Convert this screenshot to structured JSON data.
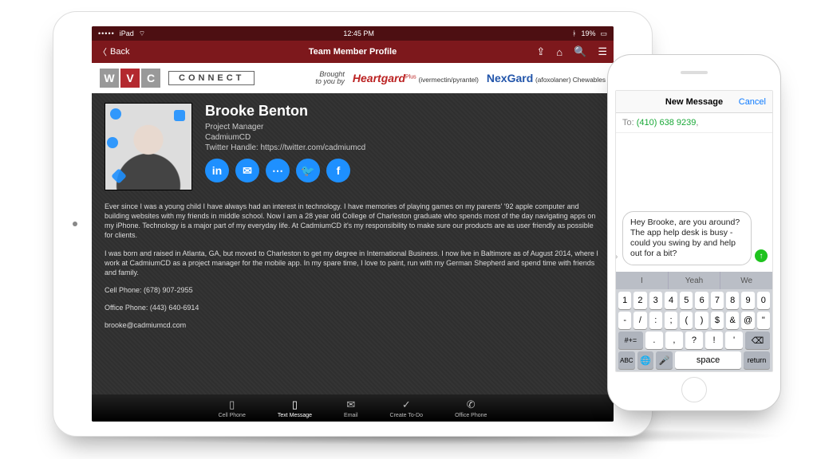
{
  "ipad": {
    "statusbar": {
      "carrier": "iPad",
      "wifi": "᯾",
      "time": "12:45 PM",
      "bt": "ᚼ",
      "battery_pct": "19%"
    },
    "navbar": {
      "back": "Back",
      "title": "Team Member Profile",
      "icons": {
        "share": "share-icon",
        "home": "home-icon",
        "search": "search-icon",
        "menu": "menu-icon"
      }
    },
    "banner": {
      "wvc_letters": [
        "W",
        "V",
        "C"
      ],
      "connect": "CONNECT",
      "brought_line1": "Brought",
      "brought_line2": "to you by",
      "heartgard": "Heartgard",
      "heartgard_sub": "(ivermectin/pyrantel)",
      "heartgard_plus": "Plus",
      "nexgard": "NexGard",
      "nexgard_sub": "(afoxolaner) Chewables"
    },
    "profile": {
      "name": "Brooke Benton",
      "role": "Project Manager",
      "company": "CadmiumCD",
      "twitter_label": "Twitter Handle: https://twitter.com/cadmiumcd",
      "socials": [
        "in",
        "✉",
        "⋯",
        "🐦",
        "f"
      ],
      "bio1": "Ever since I was a young child I have always had an interest in technology. I have memories of playing games on my parents' '92 apple computer and building websites with my friends in middle school. Now I am a 28 year old College of Charleston graduate who spends most of the day navigating apps on my iPhone. Technology is a major part of my everyday life. At CadmiumCD it's my responsibility to make sure our products are as user friendly as possible for clients.",
      "bio2": "I was born and raised in Atlanta, GA, but moved to Charleston to get my degree in International Business. I now live in Baltimore as of August 2014, where I work at CadmiumCD as a project manager for the mobile app. In my spare time, I love to paint, run with my German Shepherd and spend time with friends and family.",
      "cell_label": "Cell Phone: (678) 907-2955",
      "office_label": "Office Phone: (443) 640-6914",
      "email": "brooke@cadmiumcd.com"
    },
    "tabbar": [
      {
        "icon": "▯",
        "label": "Cell Phone"
      },
      {
        "icon": "▯",
        "label": "Text Message"
      },
      {
        "icon": "✉",
        "label": "Email"
      },
      {
        "icon": "✓",
        "label": "Create To-Do"
      },
      {
        "icon": "✆",
        "label": "Office Phone"
      }
    ]
  },
  "iphone": {
    "header": {
      "title": "New Message",
      "cancel": "Cancel"
    },
    "to_label": "To:",
    "to_number": "(410) 638 9239",
    "to_comma": ",",
    "draft": "Hey Brooke, are you around? The app help desk is busy - could you swing by and help out for a bit?",
    "predictive": [
      "I",
      "Yeah",
      "We"
    ],
    "rows": {
      "r1": [
        "1",
        "2",
        "3",
        "4",
        "5",
        "6",
        "7",
        "8",
        "9",
        "0"
      ],
      "r2": [
        "-",
        "/",
        ":",
        ";",
        "(",
        ")",
        "$",
        "&",
        "@",
        "\""
      ],
      "r3_shift": "#+=",
      "r3": [
        ".",
        ",",
        "?",
        "!",
        "'"
      ],
      "r3_del": "⌫",
      "r4": {
        "abc": "ABC",
        "globe": "🌐",
        "mic": "🎤",
        "space": "space",
        "return": "return"
      }
    }
  }
}
